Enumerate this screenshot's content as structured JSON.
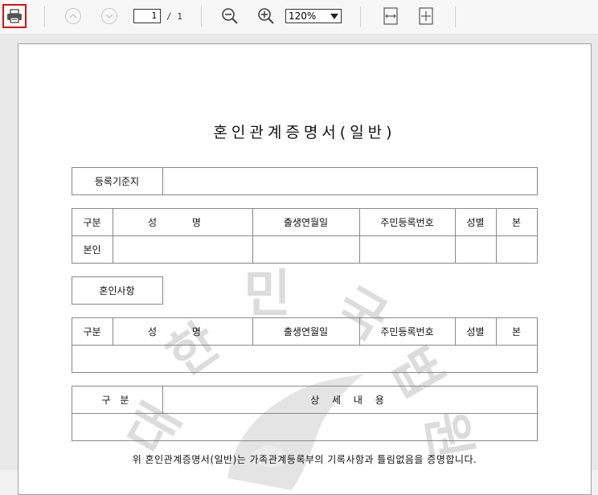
{
  "toolbar": {
    "page_current": "1",
    "page_total": "/ 1",
    "zoom": "120%"
  },
  "document": {
    "title": "혼인관계증명서(일반)",
    "reg_label": "등록기준지",
    "table1_headers": [
      "구분",
      "성 명",
      "출생연월일",
      "주민등록번호",
      "성별",
      "본"
    ],
    "self_label": "본인",
    "marriage_label": "혼인사항",
    "table2_headers": [
      "구분",
      "성 명",
      "출생연월일",
      "주민등록번호",
      "성별",
      "본"
    ],
    "detail_headers": [
      "구 분",
      "상 세 내 용"
    ],
    "footer": "위 혼인관계증명서(일반)는 가족관계등록부의 기록사항과 틀림없음을 증명합니다.",
    "watermark": [
      "대",
      "한",
      "민",
      "국",
      "법",
      "원"
    ]
  }
}
